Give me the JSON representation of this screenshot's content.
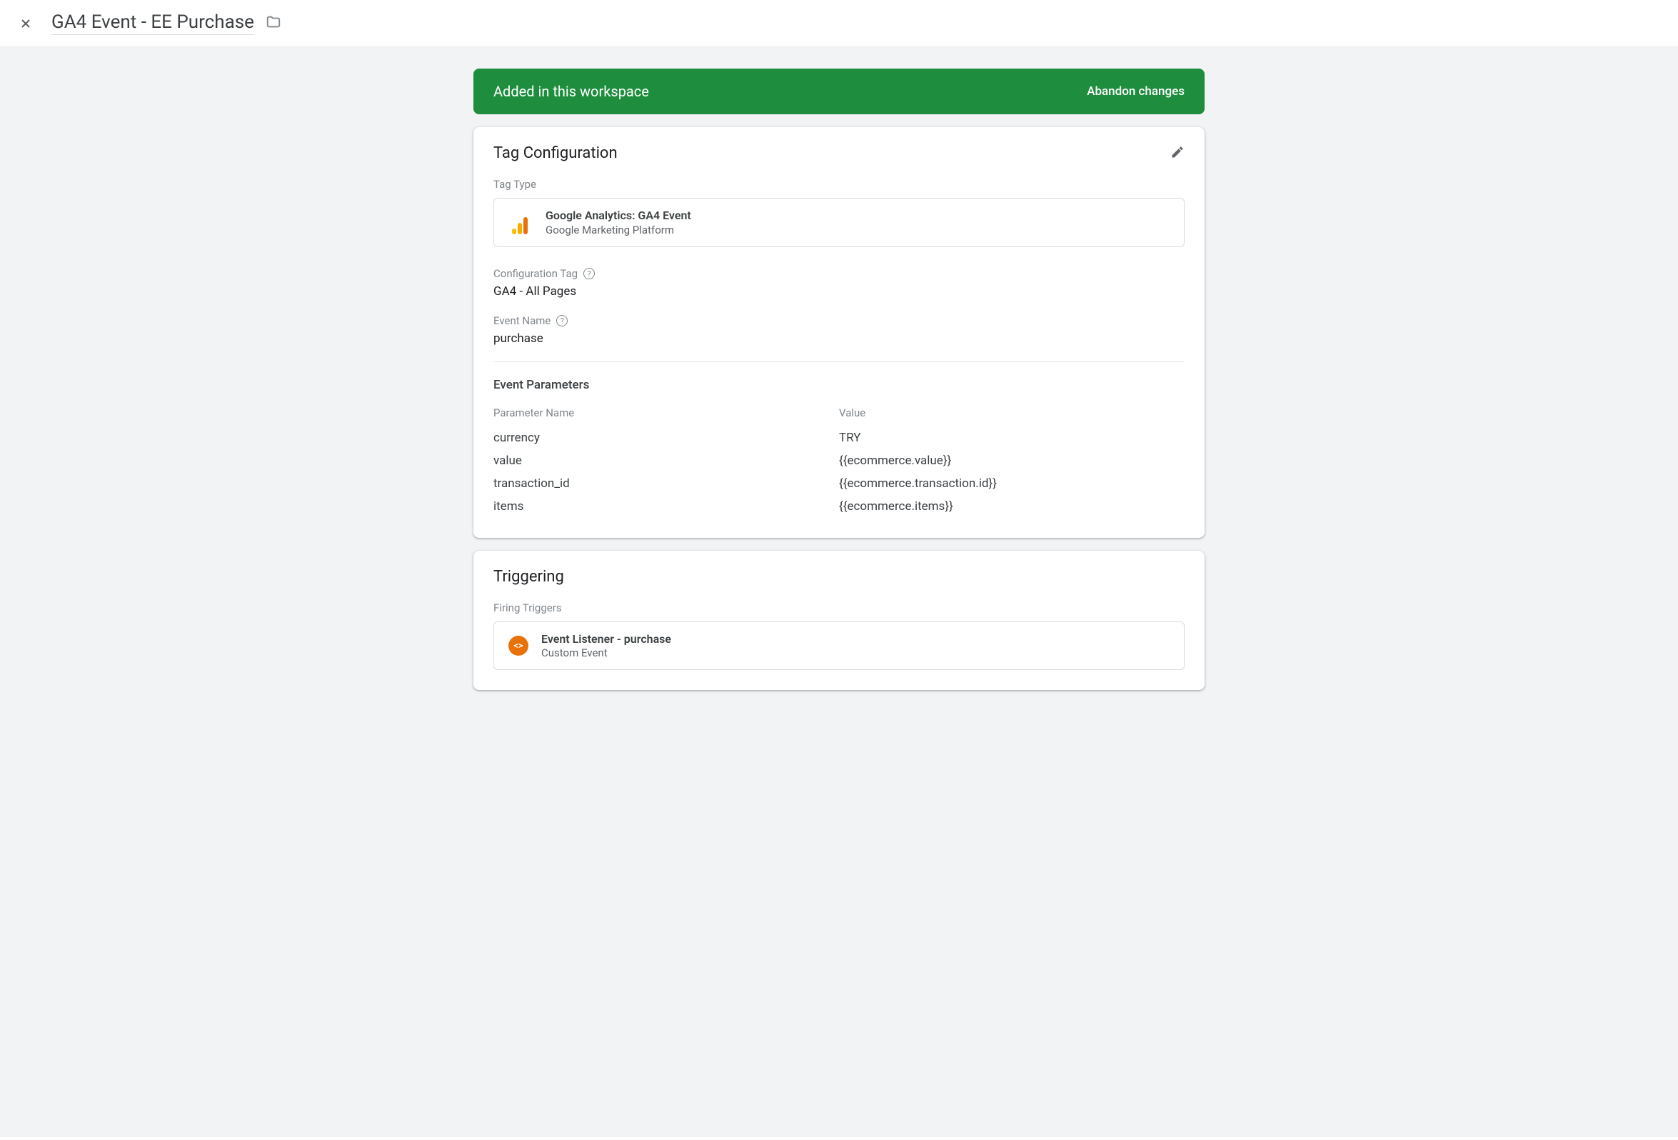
{
  "header": {
    "title": "GA4 Event - EE Purchase"
  },
  "banner": {
    "message": "Added in this workspace",
    "action": "Abandon changes"
  },
  "tag_config": {
    "title": "Tag Configuration",
    "tag_type_label": "Tag Type",
    "tag_type_name": "Google Analytics: GA4 Event",
    "tag_type_sub": "Google Marketing Platform",
    "config_tag_label": "Configuration Tag",
    "config_tag_value": "GA4 - All Pages",
    "event_name_label": "Event Name",
    "event_name_value": "purchase",
    "event_params_title": "Event Parameters",
    "param_name_header": "Parameter Name",
    "param_value_header": "Value",
    "params": [
      {
        "name": "currency",
        "value": "TRY"
      },
      {
        "name": "value",
        "value": "{{ecommerce.value}}"
      },
      {
        "name": "transaction_id",
        "value": "{{ecommerce.transaction.id}}"
      },
      {
        "name": "items",
        "value": "{{ecommerce.items}}"
      }
    ]
  },
  "triggering": {
    "title": "Triggering",
    "firing_label": "Firing Triggers",
    "trigger_name": "Event Listener - purchase",
    "trigger_type": "Custom Event"
  }
}
